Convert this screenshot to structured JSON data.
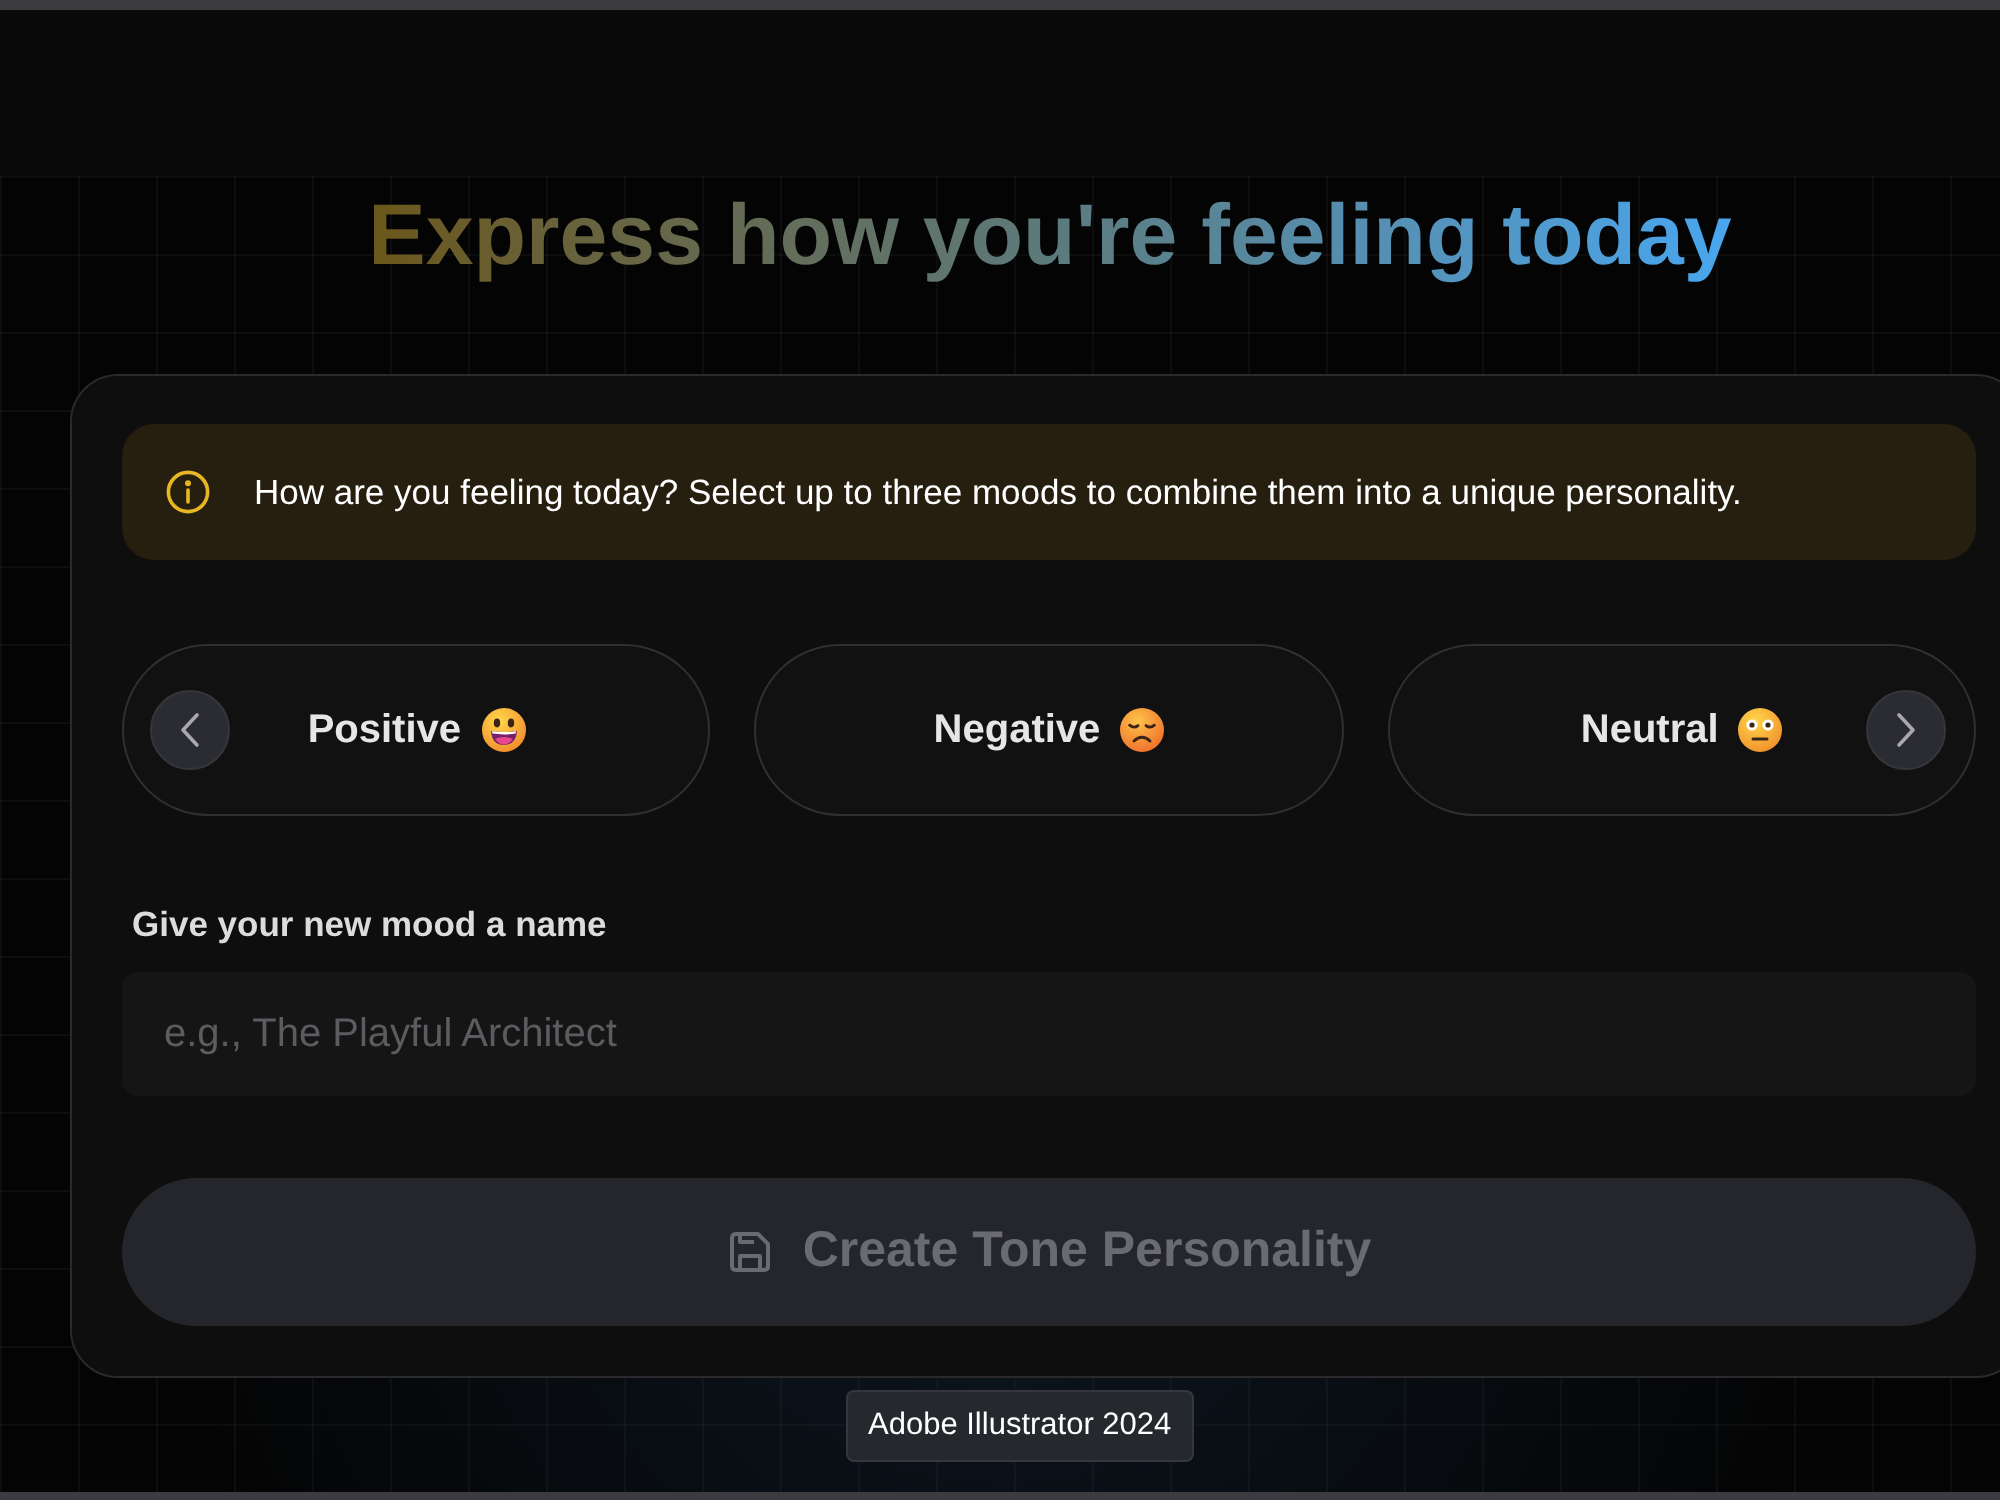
{
  "title": "Express how you're feeling today",
  "notice": {
    "text": "How are you feeling today? Select up to three moods to combine them into a unique personality."
  },
  "moods": [
    {
      "label": "Positive",
      "kind": "happy",
      "selected": false
    },
    {
      "label": "Negative",
      "kind": "sad",
      "selected": false
    },
    {
      "label": "Neutral",
      "kind": "blank",
      "selected": false
    }
  ],
  "name_field": {
    "label": "Give your new mood a name",
    "placeholder": "e.g., The Playful Architect"
  },
  "create_button": {
    "label": "Create Tone Personality",
    "disabled": true
  },
  "tooltip": {
    "text": "Adobe Illustrator 2024"
  }
}
